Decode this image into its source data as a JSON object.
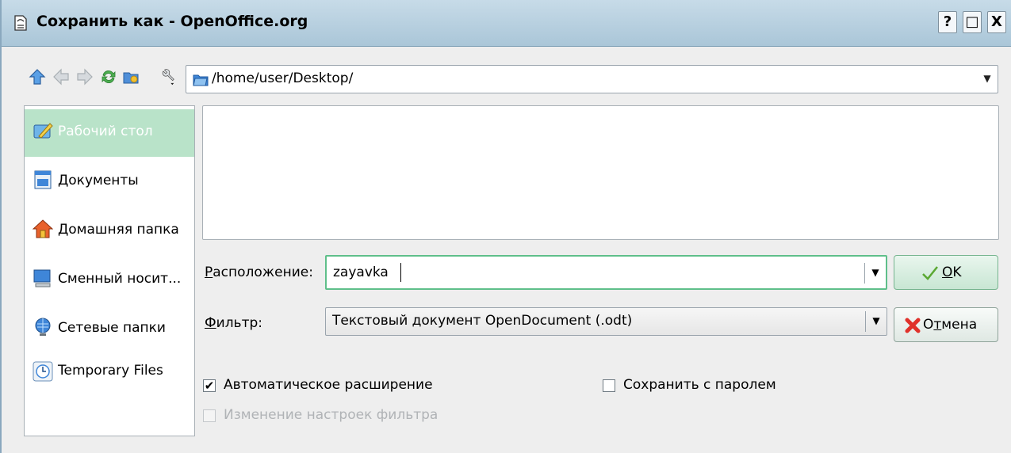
{
  "window": {
    "title": "Сохранить как - OpenOffice.org",
    "help_btn": "?",
    "max_btn": "□",
    "close_btn": "X"
  },
  "toolbar": {
    "icons": [
      "up-arrow-icon",
      "back-arrow-icon",
      "forward-arrow-icon",
      "reload-icon",
      "new-folder-icon",
      "wrench-icon"
    ],
    "path": "/home/user/Desktop/"
  },
  "sidebar": {
    "items": [
      {
        "label": "Рабочий стол",
        "icon": "desktop-icon",
        "selected": true
      },
      {
        "label": "Документы",
        "icon": "documents-icon"
      },
      {
        "label": "Домашняя папка",
        "icon": "home-icon"
      },
      {
        "label": "Сменный носит...",
        "icon": "removable-media-icon"
      },
      {
        "label": "Сетевые папки",
        "icon": "network-folder-icon"
      },
      {
        "label": "Temporary Files",
        "icon": "clock-icon"
      }
    ]
  },
  "location": {
    "label_prefix": "Р",
    "label_rest": "асположение:",
    "value": "zayavka"
  },
  "filter": {
    "label_prefix": "Ф",
    "label_rest": "ильтр:",
    "value": "Текстовый документ OpenDocument (.odt)"
  },
  "buttons": {
    "ok_prefix": "O",
    "ok_rest": "K",
    "cancel_pre": "О",
    "cancel_u": "т",
    "cancel_rest": "мена"
  },
  "options": {
    "auto_ext_label": "Автоматическое расширение",
    "auto_ext_checked": "✔",
    "password_label": "Сохранить с паролем",
    "filter_settings_label": "Изменение настроек фильтра"
  },
  "colors": {
    "selection": "#b9e3c9",
    "titlebar": "#b4cddd",
    "focus_border": "#5fbf8a"
  }
}
